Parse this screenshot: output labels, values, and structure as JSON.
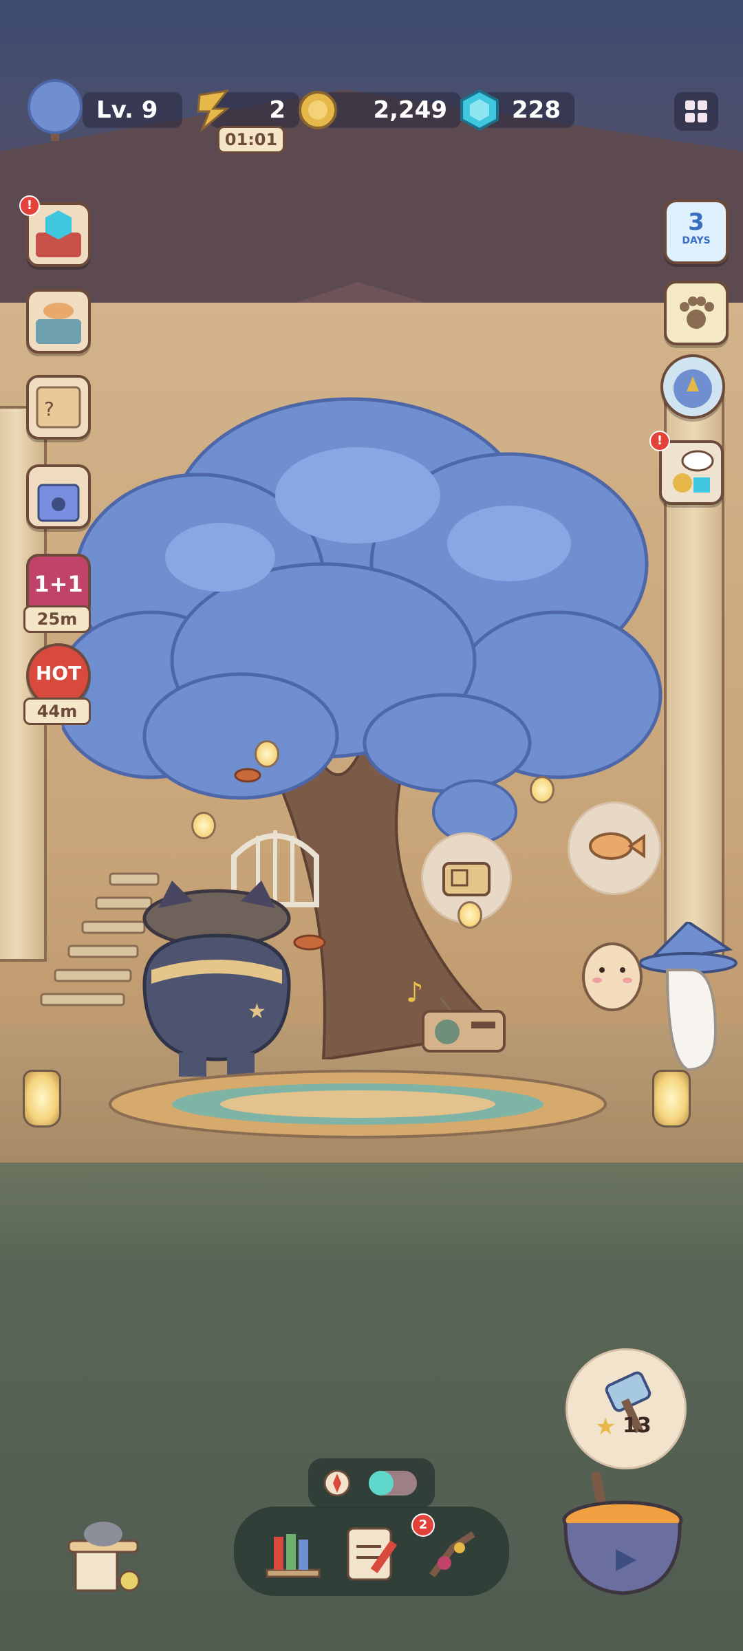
{
  "hud": {
    "level": "Lv. 9",
    "energy": "2",
    "energy_timer": "01:01",
    "coins": "2,249",
    "gems": "228"
  },
  "left_side": {
    "offer_1plus1_label": "1+1",
    "offer_1plus1_timer": "25m",
    "hot_label": "HOT",
    "hot_timer": "44m"
  },
  "right_side": {
    "calendar_days_number": "3",
    "calendar_days_label": "DAYS"
  },
  "bottom": {
    "quest_badge": "2",
    "craft_star_count": "13"
  },
  "colors": {
    "leaves": "#6f8fd0",
    "trunk": "#7b5a48",
    "alert": "#e3423b",
    "gem": "#3fc7e0",
    "coin": "#e6b84a",
    "toggle": "#5ed6c9"
  }
}
